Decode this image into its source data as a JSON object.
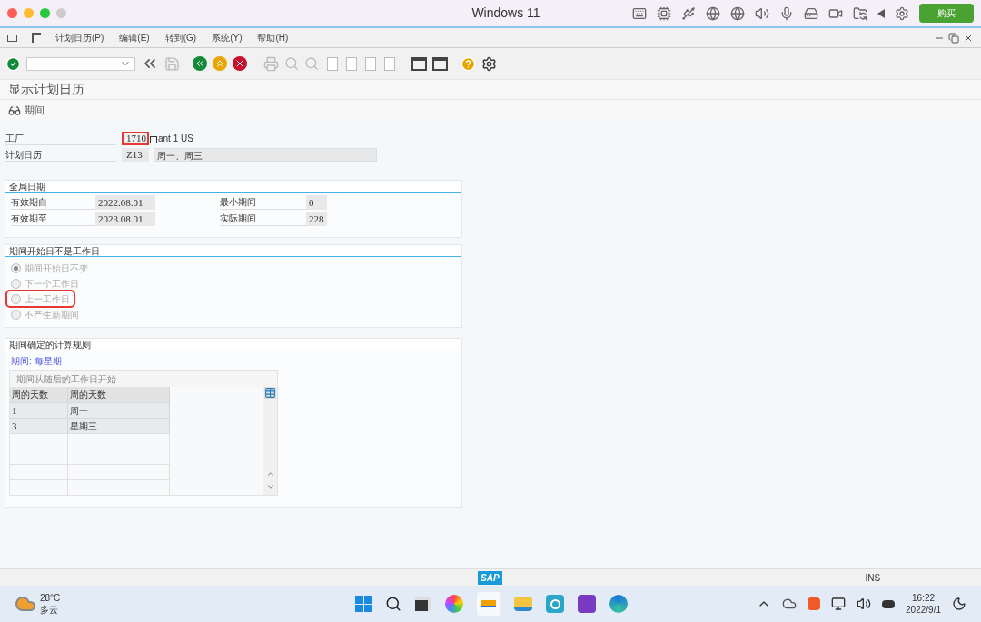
{
  "window": {
    "title": "Windows 11",
    "buy_button": "购买"
  },
  "menu": [
    {
      "label": "计划日历(P)"
    },
    {
      "label": "编辑(E)"
    },
    {
      "label": "转到(G)"
    },
    {
      "label": "系统(Y)"
    },
    {
      "label": "帮助(H)"
    }
  ],
  "screen_title": "显示计划日历",
  "subtoolbar": {
    "label": "期间"
  },
  "header": [
    {
      "label": "工厂",
      "value": "1710",
      "focused": true,
      "description": "ant 1 US"
    },
    {
      "label": "计划日历",
      "value": "Z13",
      "focused": false,
      "description": "周一、周三"
    }
  ],
  "global_dates": {
    "title": "全局日期",
    "fields": [
      {
        "label": "有效期自",
        "value": "2022.08.01"
      },
      {
        "label": "最小期间",
        "value": "0"
      },
      {
        "label": "有效期至",
        "value": "2023.08.01"
      },
      {
        "label": "实际期间",
        "value": "228"
      }
    ]
  },
  "start_not_workday": {
    "title": "期间开始日不是工作日",
    "options": [
      {
        "label": "期间开始日不变",
        "selected": true,
        "disabled": true,
        "highlighted": false
      },
      {
        "label": "下一个工作日",
        "selected": false,
        "disabled": true,
        "highlighted": false
      },
      {
        "label": "上一工作日",
        "selected": false,
        "disabled": true,
        "highlighted": true
      },
      {
        "label": "不产生新期间",
        "selected": false,
        "disabled": true,
        "highlighted": false
      }
    ]
  },
  "rules": {
    "title": "期间确定的计算规则",
    "period": "期间: 每星期",
    "table": {
      "title": "期间从随后的工作日开始",
      "columns": [
        "周的天数",
        "周的天数"
      ],
      "rows": [
        [
          "1",
          "周一"
        ],
        [
          "3",
          "星期三"
        ]
      ]
    }
  },
  "status_bar": {
    "logo": "SAP",
    "mode": "INS"
  },
  "taskbar": {
    "temperature": "28°C",
    "weather": "多云",
    "time": "16:22",
    "date": "2022/9/1"
  }
}
